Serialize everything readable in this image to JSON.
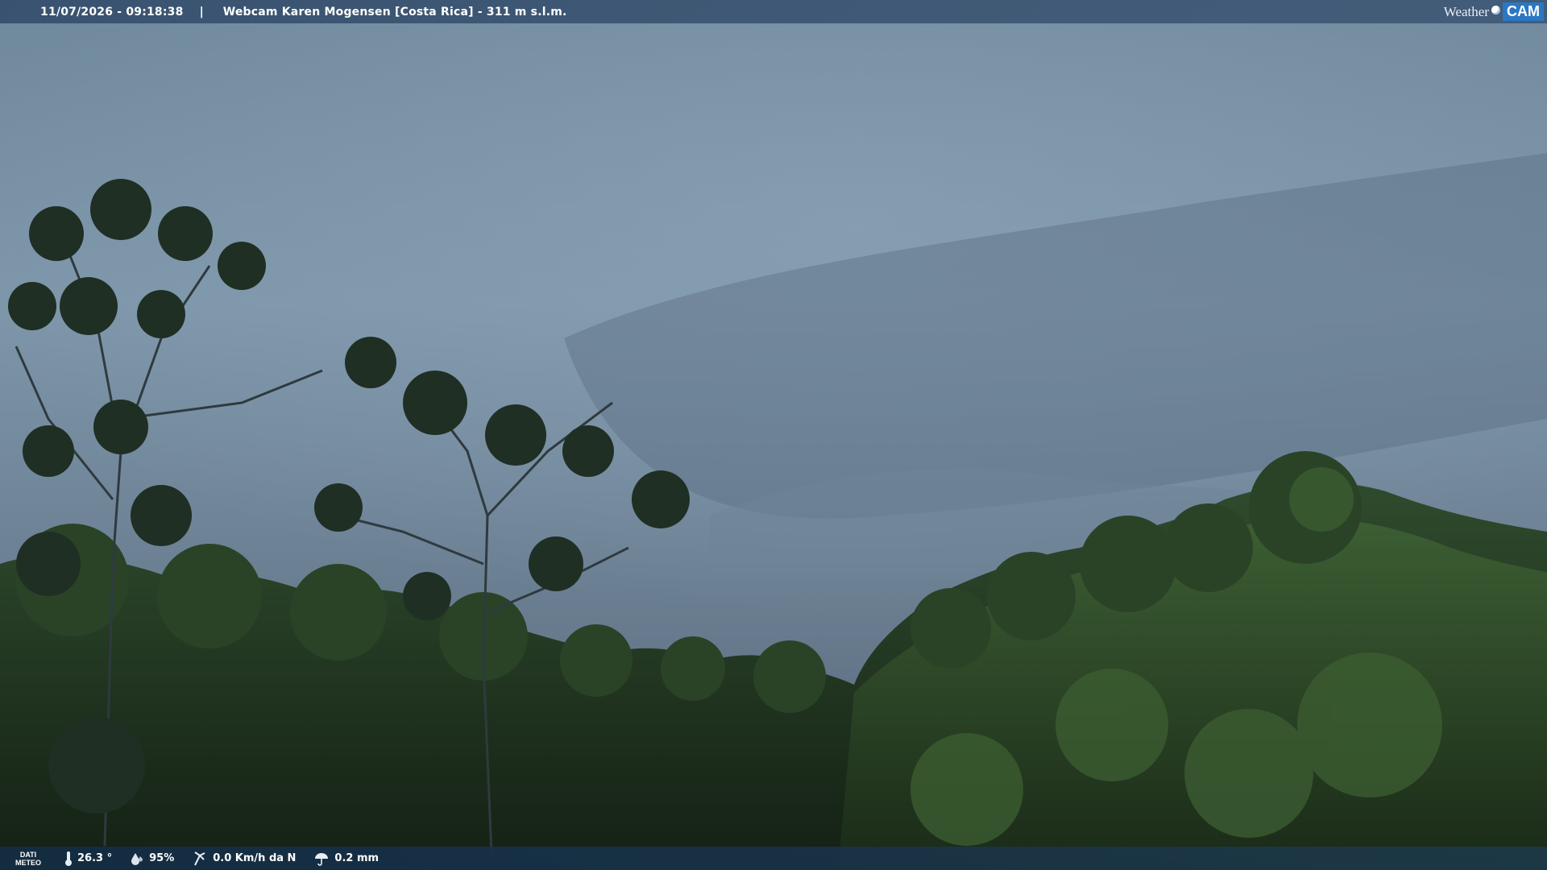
{
  "header": {
    "timestamp": "11/07/2026 - 09:18:38",
    "separator": "|",
    "title": "Webcam Karen Mogensen [Costa Rica] - 311 m s.l.m.",
    "brand_left": "Weather",
    "brand_right": "CAM"
  },
  "weather": {
    "section_label_line1": "DATI",
    "section_label_line2": "METEO",
    "temperature": "26.3 °",
    "humidity": "95%",
    "wind": "0.0 Km/h da N",
    "rain": "0.2 mm",
    "icons": [
      "thermometer-icon",
      "humidity-drop-icon",
      "wind-icon",
      "rain-icon"
    ]
  },
  "colors": {
    "sky_top": "#7f97ab",
    "sky_bottom": "#5f768b",
    "forest_dark": "#1b2a1c",
    "forest_mid": "#2e4a2a",
    "foliage_light": "#4d6f3a",
    "bar_blue": "#2b77c2"
  }
}
